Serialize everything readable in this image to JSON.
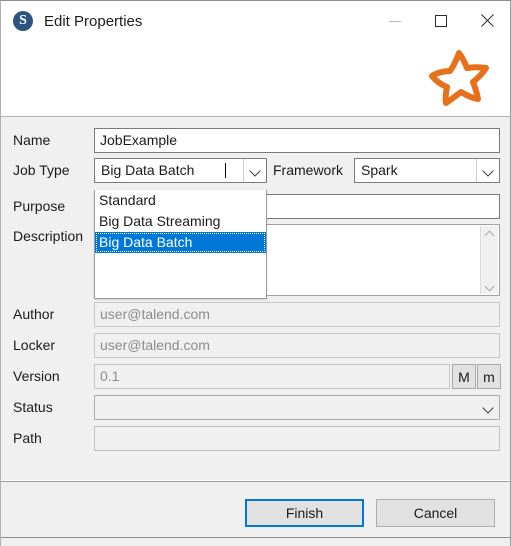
{
  "window": {
    "title": "Edit Properties",
    "icon": "talend-logo-icon",
    "minimize_label": "Minimize",
    "maximize_label": "Maximize",
    "close_label": "Close"
  },
  "banner": {
    "logo": "orange-star-logo",
    "logo_color": "#E8701A"
  },
  "form": {
    "name": {
      "label": "Name",
      "value": "JobExample",
      "placeholder": ""
    },
    "job_type": {
      "label": "Job Type",
      "value": "Big Data Batch",
      "options": [
        "Standard",
        "Big Data Streaming",
        "Big Data Batch"
      ],
      "selected_option": "Big Data Batch",
      "expanded": true
    },
    "framework": {
      "label": "Framework",
      "value": "Spark",
      "options": [
        "Spark"
      ]
    },
    "purpose": {
      "label": "Purpose",
      "value": "",
      "placeholder": ""
    },
    "description": {
      "label": "Description",
      "value": "",
      "placeholder": ""
    },
    "author": {
      "label": "Author",
      "value": "user@talend.com",
      "disabled": true
    },
    "locker": {
      "label": "Locker",
      "value": "user@talend.com",
      "disabled": true
    },
    "version": {
      "label": "Version",
      "value": "0.1",
      "disabled": true,
      "major_button": "M",
      "minor_button": "m"
    },
    "status": {
      "label": "Status",
      "value": "",
      "options": []
    },
    "path": {
      "label": "Path",
      "value": "",
      "disabled": true
    }
  },
  "buttons": {
    "finish": "Finish",
    "cancel": "Cancel",
    "focus_color": "#0078D7"
  },
  "colors": {
    "highlight": "#0078D7",
    "dialog_background": "#F0F0F0",
    "accent_orange": "#E8701A",
    "title_icon": "#2B5580"
  }
}
